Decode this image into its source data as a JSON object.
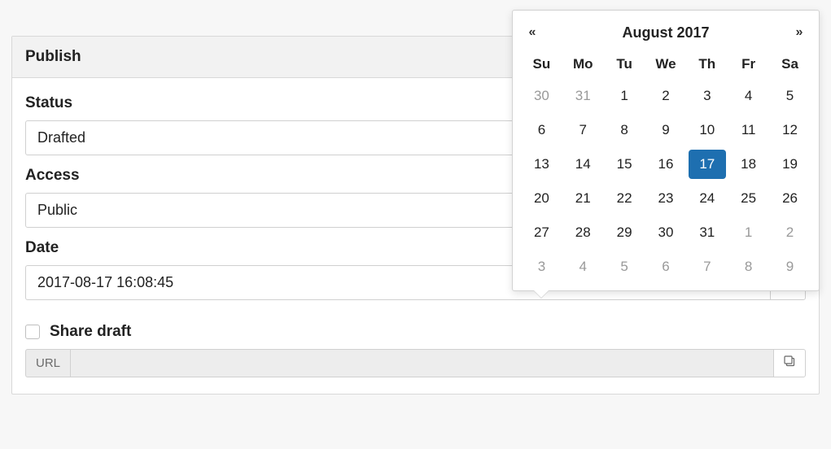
{
  "panel": {
    "title": "Publish",
    "status_label": "Status",
    "status_value": "Drafted",
    "access_label": "Access",
    "access_value": "Public",
    "date_label": "Date",
    "date_value": "2017-08-17 16:08:45",
    "share_draft_label": "Share draft",
    "share_draft_checked": false,
    "url_addon": "URL",
    "url_value": ""
  },
  "icons": {
    "caret_down": "caret-down-icon",
    "calendar": "calendar-icon",
    "copy": "copy-icon",
    "prev": "«",
    "next": "»"
  },
  "datepicker": {
    "title": "August 2017",
    "selected": 17,
    "weekdays": [
      "Su",
      "Mo",
      "Tu",
      "We",
      "Th",
      "Fr",
      "Sa"
    ],
    "weeks": [
      [
        {
          "d": 30,
          "muted": true
        },
        {
          "d": 31,
          "muted": true
        },
        {
          "d": 1
        },
        {
          "d": 2
        },
        {
          "d": 3
        },
        {
          "d": 4
        },
        {
          "d": 5
        }
      ],
      [
        {
          "d": 6
        },
        {
          "d": 7
        },
        {
          "d": 8
        },
        {
          "d": 9
        },
        {
          "d": 10
        },
        {
          "d": 11
        },
        {
          "d": 12
        }
      ],
      [
        {
          "d": 13
        },
        {
          "d": 14
        },
        {
          "d": 15
        },
        {
          "d": 16
        },
        {
          "d": 17,
          "selected": true
        },
        {
          "d": 18
        },
        {
          "d": 19
        }
      ],
      [
        {
          "d": 20
        },
        {
          "d": 21
        },
        {
          "d": 22
        },
        {
          "d": 23
        },
        {
          "d": 24
        },
        {
          "d": 25
        },
        {
          "d": 26
        }
      ],
      [
        {
          "d": 27
        },
        {
          "d": 28
        },
        {
          "d": 29
        },
        {
          "d": 30
        },
        {
          "d": 31
        },
        {
          "d": 1,
          "muted": true
        },
        {
          "d": 2,
          "muted": true
        }
      ],
      [
        {
          "d": 3,
          "muted": true
        },
        {
          "d": 4,
          "muted": true
        },
        {
          "d": 5,
          "muted": true
        },
        {
          "d": 6,
          "muted": true
        },
        {
          "d": 7,
          "muted": true
        },
        {
          "d": 8,
          "muted": true
        },
        {
          "d": 9,
          "muted": true
        }
      ]
    ]
  },
  "colors": {
    "accent": "#1e6fb0",
    "panel_header_bg": "#f2f2f2",
    "border": "#d0d0d0"
  }
}
